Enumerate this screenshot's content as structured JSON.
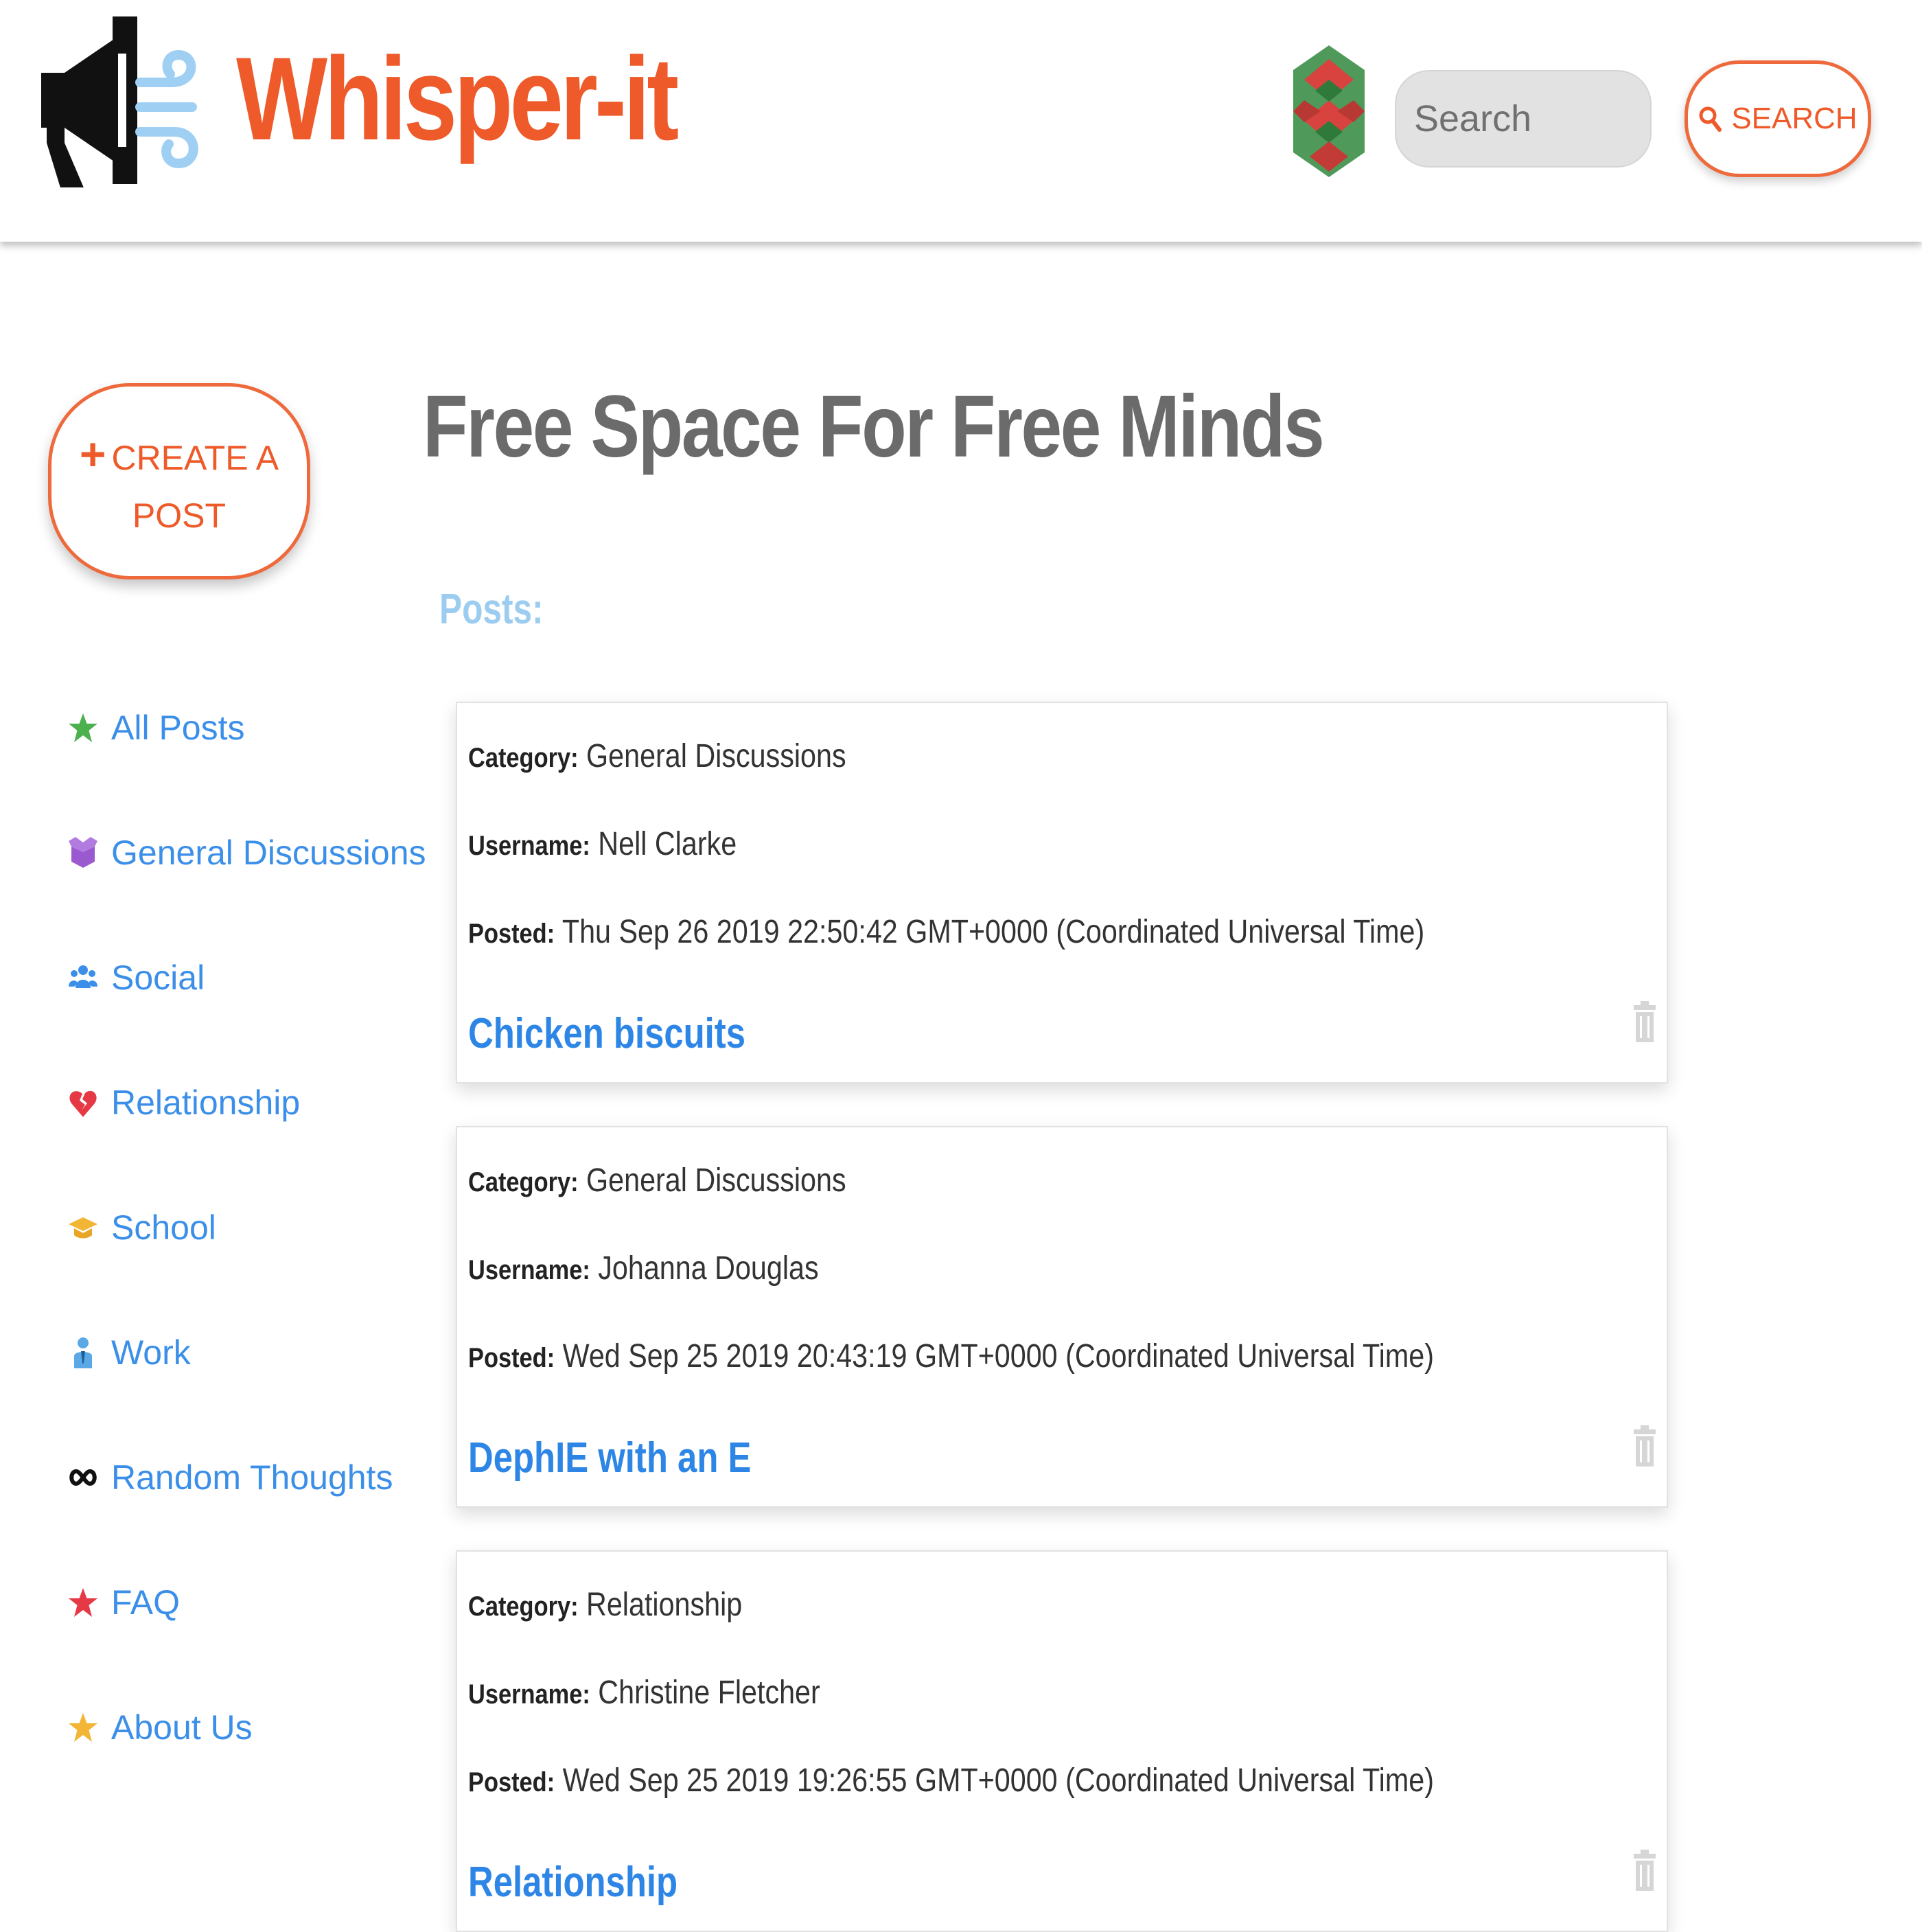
{
  "header": {
    "brand": "Whisper-it",
    "search_placeholder": "Search",
    "search_button_label": "SEARCH"
  },
  "sidebar": {
    "create_post_line1": "CREATE A",
    "create_post_line2": "POST",
    "items": [
      {
        "label": "All Posts",
        "icon": "star-icon",
        "color": "#4cb04f"
      },
      {
        "label": "General Discussions",
        "icon": "box-icon",
        "color": "#9b59d0"
      },
      {
        "label": "Social",
        "icon": "users-icon",
        "color": "#3b8fe8"
      },
      {
        "label": "Relationship",
        "icon": "broken-heart-icon",
        "color": "#e53946"
      },
      {
        "label": "School",
        "icon": "graduation-cap-icon",
        "color": "#f2b535"
      },
      {
        "label": "Work",
        "icon": "worker-icon",
        "color": "#5aa9e6"
      },
      {
        "label": "Random Thoughts",
        "icon": "infinity-icon",
        "color": "#111111"
      },
      {
        "label": "FAQ",
        "icon": "star-icon",
        "color": "#e53946"
      },
      {
        "label": "About Us",
        "icon": "star-icon",
        "color": "#f2b535"
      }
    ]
  },
  "main": {
    "title": "Free Space For Free Minds",
    "posts_heading": "Posts:",
    "labels": {
      "category": "Category:",
      "username": "Username:",
      "posted": "Posted:"
    },
    "posts": [
      {
        "category": "General Discussions",
        "username": "Nell Clarke",
        "posted": "Thu Sep 26 2019 22:50:42 GMT+0000 (Coordinated Universal Time)",
        "title": "Chicken biscuits"
      },
      {
        "category": "General Discussions",
        "username": "Johanna Douglas",
        "posted": "Wed Sep 25 2019 20:43:19 GMT+0000 (Coordinated Universal Time)",
        "title": "DephIE with an E"
      },
      {
        "category": "Relationship",
        "username": "Christine Fletcher",
        "posted": "Wed Sep 25 2019 19:26:55 GMT+0000 (Coordinated Universal Time)",
        "title": "Relationship"
      }
    ]
  },
  "colors": {
    "brand": "#ee5a2a",
    "link": "#2d86e6",
    "posts_heading": "#9ccdf0",
    "title": "#6b6b6b"
  }
}
